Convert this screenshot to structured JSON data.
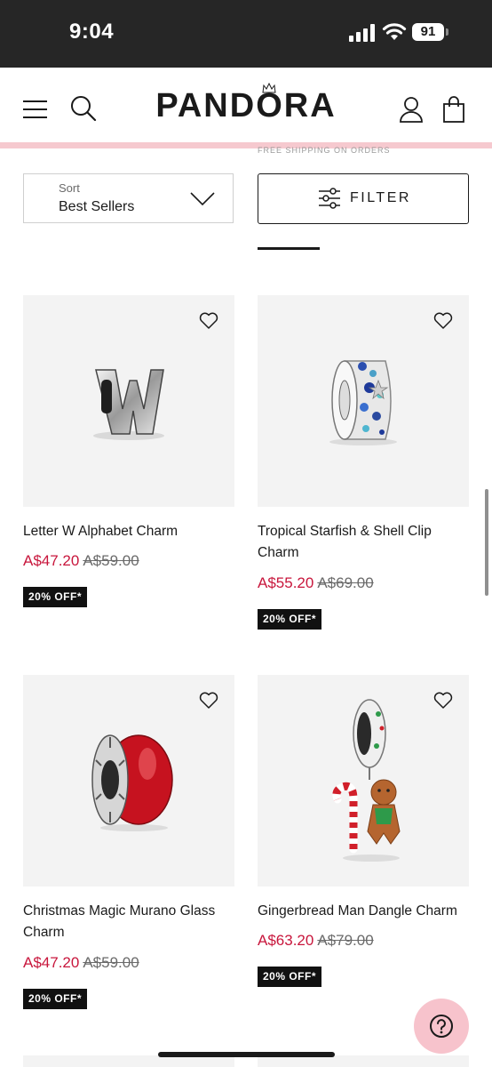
{
  "status_bar": {
    "time": "9:04",
    "battery": "91"
  },
  "header": {
    "logo": "PANDORA",
    "promo": "FREE SHIPPING ON ORDERS OVER"
  },
  "sort": {
    "label": "Sort",
    "value": "Best Sellers"
  },
  "filter": {
    "label": "FILTER"
  },
  "products": [
    {
      "name": "Letter W Alphabet Charm",
      "price": "A$47.20",
      "original_price": "A$59.00",
      "badge": "20% OFF*"
    },
    {
      "name": "Tropical Starfish & Shell Clip Charm",
      "price": "A$55.20",
      "original_price": "A$69.00",
      "badge": "20% OFF*"
    },
    {
      "name": "Christmas Magic Murano Glass Charm",
      "price": "A$47.20",
      "original_price": "A$59.00",
      "badge": "20% OFF*"
    },
    {
      "name": "Gingerbread Man Dangle Charm",
      "price": "A$63.20",
      "original_price": "A$79.00",
      "badge": "20% OFF*"
    }
  ],
  "colors": {
    "sale_price": "#c8163c",
    "accent_pink": "#f6c9cf",
    "badge_bg": "#111111"
  },
  "icons": [
    "signal-icon",
    "wifi-icon",
    "battery-icon",
    "menu-icon",
    "search-icon",
    "account-icon",
    "bag-icon",
    "chevron-down-icon",
    "filter-icon",
    "heart-icon",
    "help-icon"
  ]
}
